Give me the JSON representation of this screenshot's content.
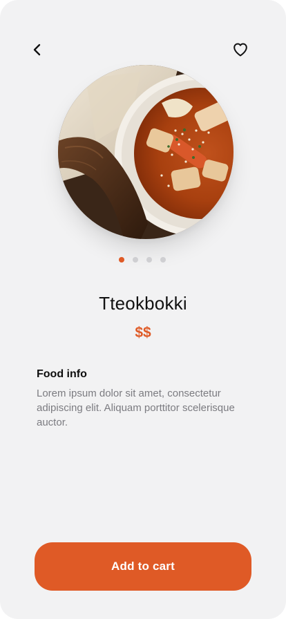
{
  "nav": {
    "back_icon": "chevron-left-icon",
    "favorite_icon": "heart-outline-icon"
  },
  "hero": {
    "image": "tteokbokki-bowl-photo"
  },
  "carousel": {
    "active_index": 0,
    "count": 4
  },
  "product": {
    "name": "Tteokbokki",
    "price": "$$"
  },
  "info": {
    "heading": "Food info",
    "body": "Lorem ipsum dolor sit amet, consectetur adipiscing elit. Aliquam porttitor scelerisque auctor."
  },
  "cta": {
    "label": "Add to cart"
  },
  "colors": {
    "accent": "#df5a26",
    "background": "#f2f2f3",
    "body_text": "#7b7b80"
  }
}
